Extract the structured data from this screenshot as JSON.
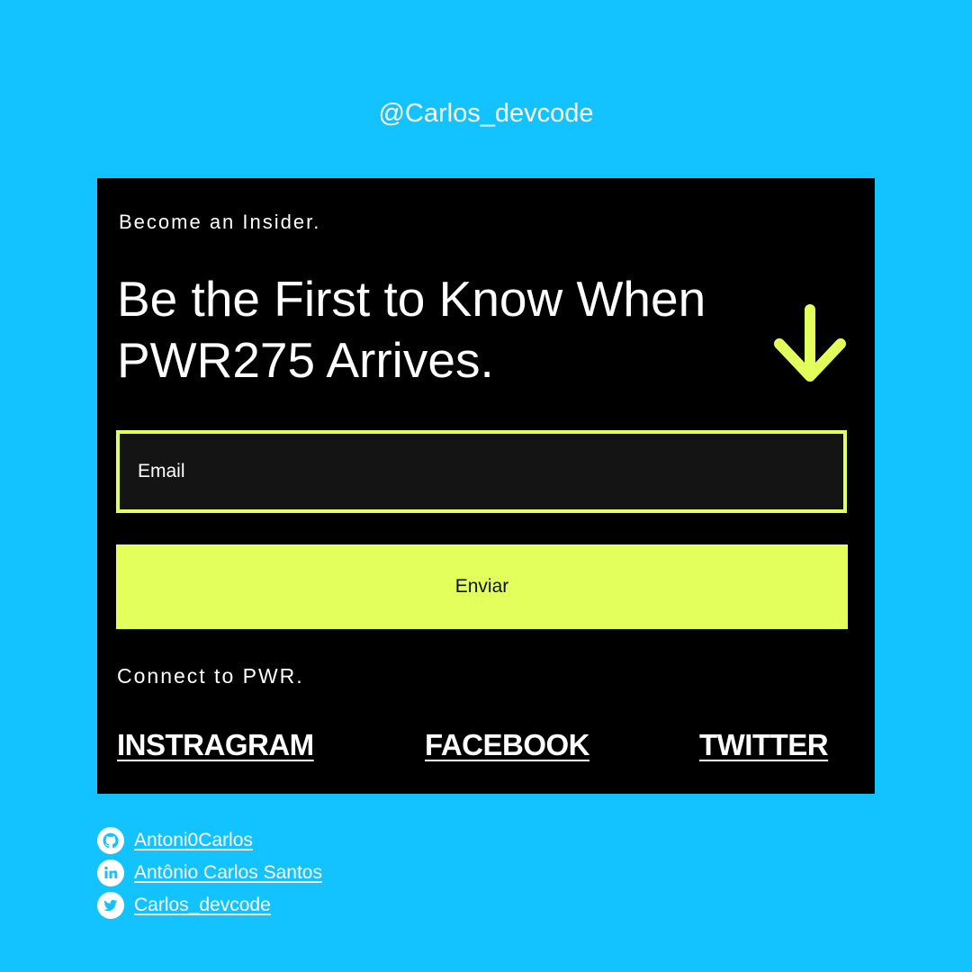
{
  "colors": {
    "background": "#13c3ff",
    "card": "#000000",
    "accent": "#e2ff5c",
    "text": "#ffffff"
  },
  "header": {
    "handle": "@Carlos_devcode"
  },
  "card": {
    "eyebrow": "Become an Insider.",
    "headline": "Be the First to Know When PWR275 Arrives.",
    "arrow_icon": "arrow-down-icon",
    "email": {
      "placeholder": "Email",
      "value": ""
    },
    "submit_label": "Enviar",
    "connect_label": "Connect to PWR.",
    "social_links": [
      {
        "label": "INSTRAGRAM"
      },
      {
        "label": "FACEBOOK"
      },
      {
        "label": "TWITTER"
      }
    ]
  },
  "footer": {
    "links": [
      {
        "icon": "github-icon",
        "label": "Antoni0Carlos"
      },
      {
        "icon": "linkedin-icon",
        "label": "Antônio Carlos Santos"
      },
      {
        "icon": "twitter-icon",
        "label": "Carlos_devcode"
      }
    ]
  }
}
